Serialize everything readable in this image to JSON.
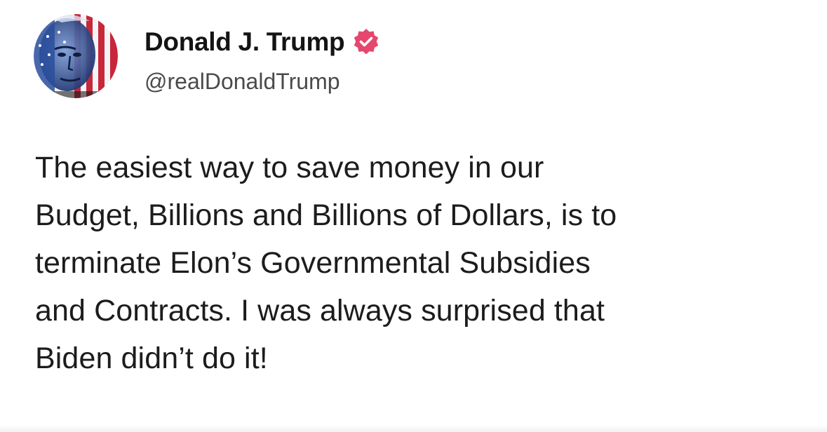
{
  "post": {
    "author_name": "Donald J. Trump",
    "author_handle": "@realDonaldTrump",
    "verified": true,
    "body": "The easiest way to save money in our\nBudget, Billions and Billions of Dollars, is to\nterminate Elon’s Governmental Subsidies\nand Contracts. I was always surprised that\nBiden didn’t do it!"
  },
  "icons": {
    "avatar": "profile-avatar-flag-face",
    "verified": "verified-badge-icon"
  },
  "colors": {
    "verified_badge": "#e5476e",
    "avatar_flag_red": "#c8263a",
    "avatar_flag_blue": "#2a4f9e",
    "text_primary": "#141414",
    "text_secondary": "#4a4a4a"
  }
}
